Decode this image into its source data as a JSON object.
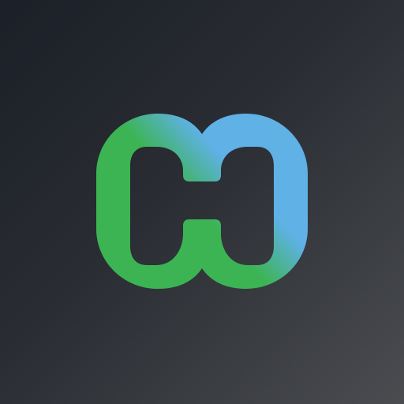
{
  "app_icon": {
    "icon": "connector-logo-icon",
    "colors": {
      "background_start": "#1b1f27",
      "background_end": "#4a4c50",
      "accent_green": "#3cb453",
      "accent_blue": "#5fb1e6"
    }
  }
}
